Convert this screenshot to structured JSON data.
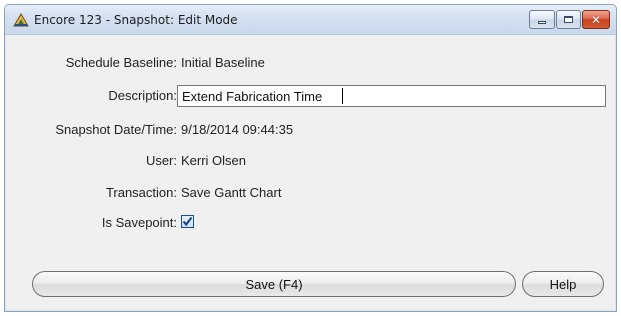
{
  "window": {
    "title": "Encore 123 - Snapshot: Edit Mode",
    "controls": {
      "minimize_icon": "minimize-icon",
      "maximize_icon": "maximize-icon",
      "close_icon": "close-icon",
      "close_glyph": "✕"
    },
    "accent_color": "#c9421f"
  },
  "form": {
    "schedule_baseline": {
      "label": "Schedule Baseline:",
      "value": "Initial Baseline"
    },
    "description": {
      "label": "Description:",
      "value": "Extend Fabrication Time"
    },
    "snapshot_datetime": {
      "label": "Snapshot Date/Time:",
      "value": "9/18/2014 09:44:35"
    },
    "user": {
      "label": "User:",
      "value": "Kerri Olsen"
    },
    "transaction": {
      "label": "Transaction:",
      "value": "Save Gantt Chart"
    },
    "is_savepoint": {
      "label": "Is Savepoint:",
      "checked": true
    }
  },
  "buttons": {
    "save_label": "Save (F4)",
    "help_label": "Help"
  }
}
